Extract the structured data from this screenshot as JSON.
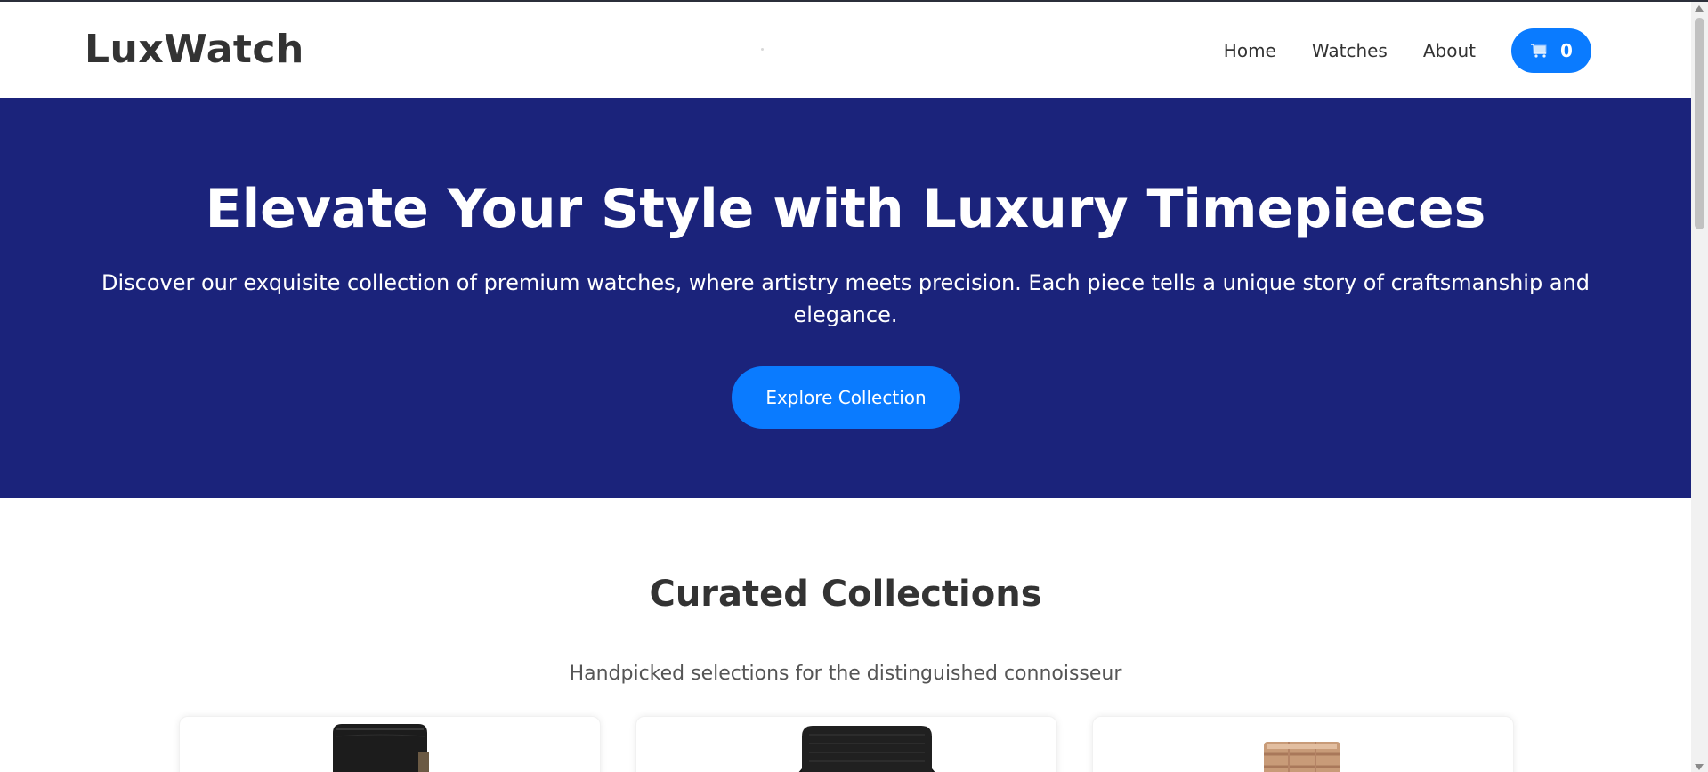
{
  "header": {
    "logo": "LuxWatch",
    "nav": [
      {
        "label": "Home"
      },
      {
        "label": "Watches"
      },
      {
        "label": "About"
      }
    ],
    "cart": {
      "icon": "cart-icon",
      "count": "0"
    }
  },
  "hero": {
    "title": "Elevate Your Style with Luxury Timepieces",
    "subtitle": "Discover our exquisite collection of premium watches, where artistry meets precision. Each piece tells a unique story of craftsmanship and elegance.",
    "cta_label": "Explore Collection"
  },
  "collections": {
    "title": "Curated Collections",
    "subtitle": "Handpicked selections for the distinguished connoisseur"
  },
  "colors": {
    "hero_bg": "#1b237b",
    "accent": "#0a7bff",
    "text_dark": "#333333",
    "text_muted": "#555555"
  }
}
